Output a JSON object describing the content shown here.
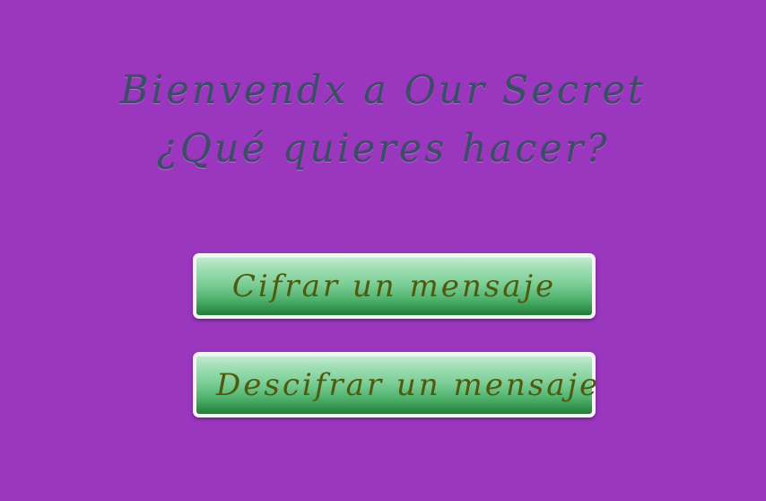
{
  "welcome": {
    "title": "Bienvendx a Our Secret",
    "question": "¿Qué quieres hacer?"
  },
  "actions": {
    "encrypt_label": "Cifrar un mensaje",
    "decrypt_label": "Descifrar un mensaje"
  },
  "colors": {
    "background": "#9b37bf",
    "heading_text": "#3a4e66",
    "button_green": "#55b673",
    "button_text": "#4f5a0e",
    "button_border": "#f4f4f4"
  }
}
